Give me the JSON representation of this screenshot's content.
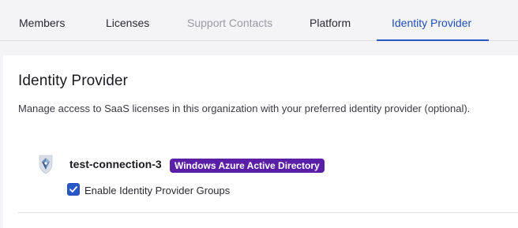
{
  "tabs": [
    {
      "label": "Members",
      "state": "default"
    },
    {
      "label": "Licenses",
      "state": "default"
    },
    {
      "label": "Support Contacts",
      "state": "disabled"
    },
    {
      "label": "Platform",
      "state": "default"
    },
    {
      "label": "Identity Provider",
      "state": "active"
    }
  ],
  "section": {
    "title": "Identity Provider",
    "description": "Manage access to SaaS licenses in this organization with your preferred identity provider (optional)."
  },
  "connection": {
    "icon": "azure-ad-icon",
    "name": "test-connection-3",
    "provider_badge": "Windows Azure Active Directory",
    "groups_checkbox": {
      "label": "Enable Identity Provider Groups",
      "checked": true
    }
  },
  "colors": {
    "accent": "#2a57c8",
    "badge": "#5a1fa6",
    "page_bg": "#f4f4f6",
    "card_bg": "#ffffff"
  }
}
